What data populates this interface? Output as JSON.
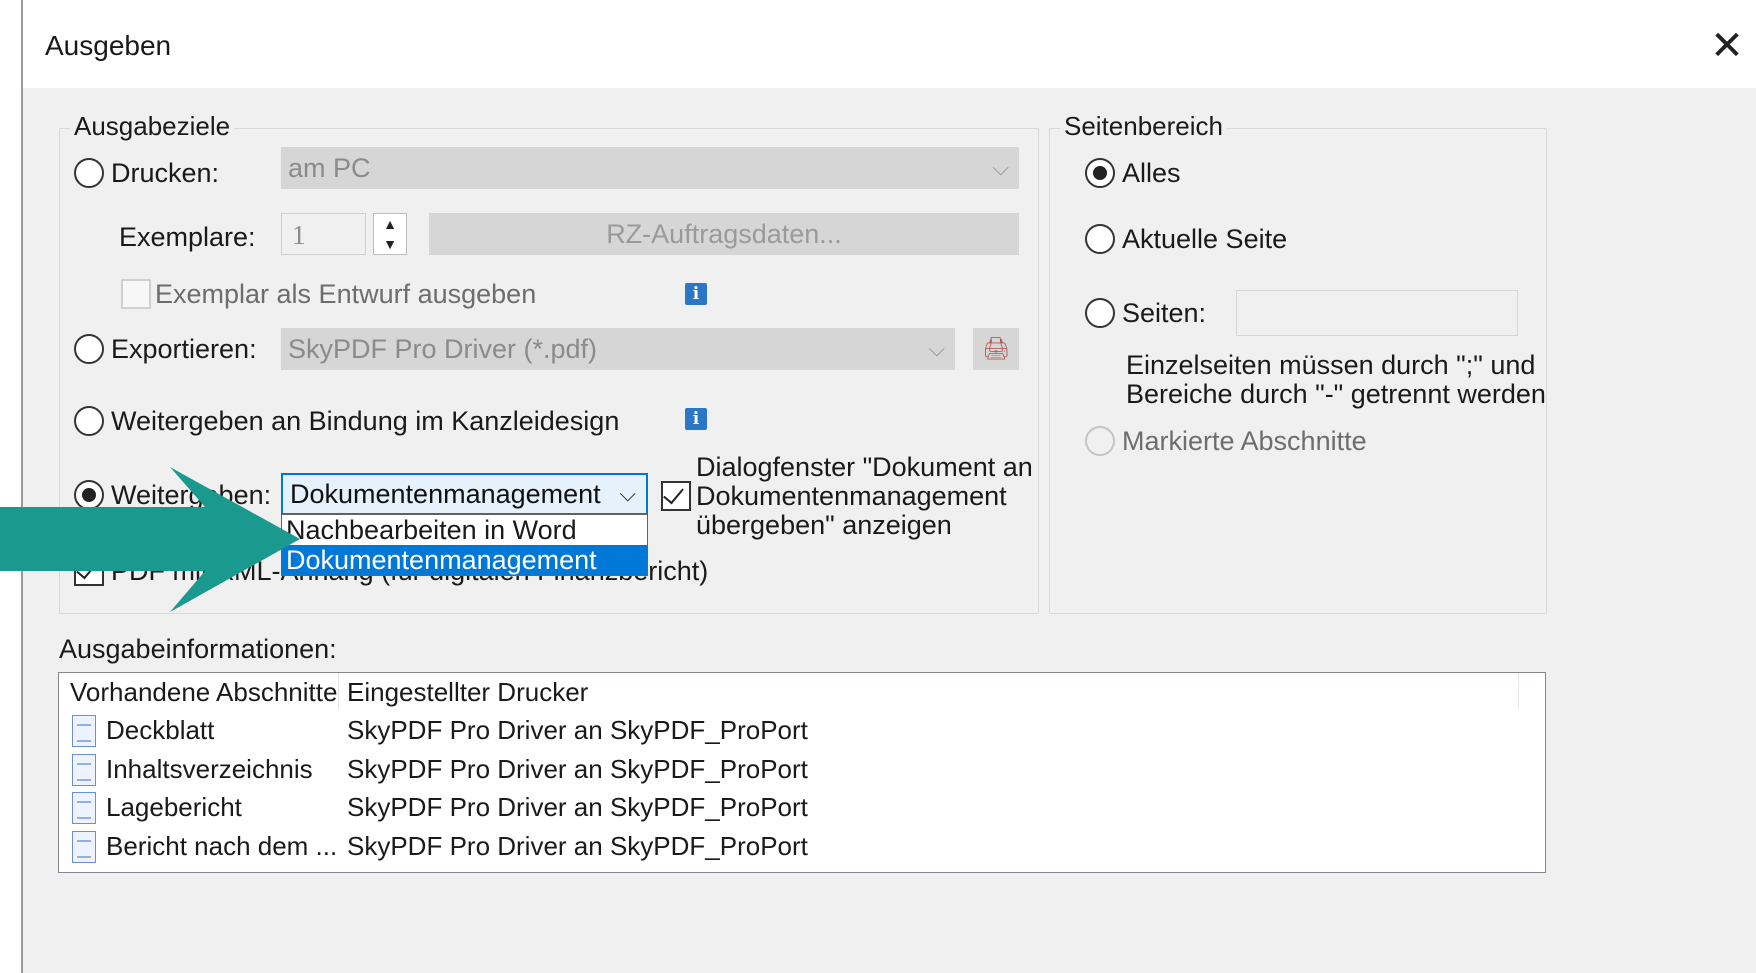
{
  "window": {
    "title": "Ausgeben"
  },
  "targets": {
    "group_title": "Ausgabeziele",
    "print": {
      "label": "Drucken:",
      "printer_value": "am PC",
      "copies_label": "Exemplare:",
      "copies_value": "1",
      "rz_button": "RZ-Auftragsdaten...",
      "draft_label": "Exemplar als Entwurf ausgeben"
    },
    "export": {
      "label": "Exportieren:",
      "driver_value": "SkyPDF Pro Driver (*.pdf)"
    },
    "binding": {
      "label": "Weitergeben an Bindung im Kanzleidesign"
    },
    "forward": {
      "label": "Weitergeben:",
      "value": "Dokumentenmanagement",
      "options": [
        "Nachbearbeiten in Word",
        "Dokumentenmanagement"
      ],
      "dialog_label_line1": "Dialogfenster \"Dokument an",
      "dialog_label_line2": "Dokumentenmanagement",
      "dialog_label_line3": "übergeben\" anzeigen"
    },
    "pdf_xml": {
      "label": "PDF mit XML-Anhang (für digitalen Finanzbericht)"
    }
  },
  "page_range": {
    "group_title": "Seitenbereich",
    "all": "Alles",
    "current": "Aktuelle Seite",
    "pages": "Seiten:",
    "hint_line1": "Einzelseiten müssen durch \";\" und",
    "hint_line2": "Bereiche durch \"-\" getrennt werden",
    "marked": "Markierte Abschnitte"
  },
  "output_info": {
    "title": "Ausgabeinformationen:",
    "columns": [
      "Vorhandene Abschnitte",
      "Eingestellter Drucker"
    ],
    "rows": [
      {
        "section": "Deckblatt",
        "printer": "SkyPDF Pro Driver an SkyPDF_ProPort"
      },
      {
        "section": "Inhaltsverzeichnis",
        "printer": "SkyPDF Pro Driver an SkyPDF_ProPort"
      },
      {
        "section": "Lagebericht",
        "printer": "SkyPDF Pro Driver an SkyPDF_ProPort"
      },
      {
        "section": "Bericht nach dem ...",
        "printer": "SkyPDF Pro Driver an SkyPDF_ProPort"
      }
    ]
  },
  "colors": {
    "accent": "#0078d7",
    "arrow": "#1a9a8e",
    "dialog_bg": "#f0f0f0"
  },
  "icons": [
    "close-icon",
    "chevron-down-icon",
    "info-icon",
    "pdf-settings-icon",
    "document-icon",
    "arrow-annotation"
  ]
}
